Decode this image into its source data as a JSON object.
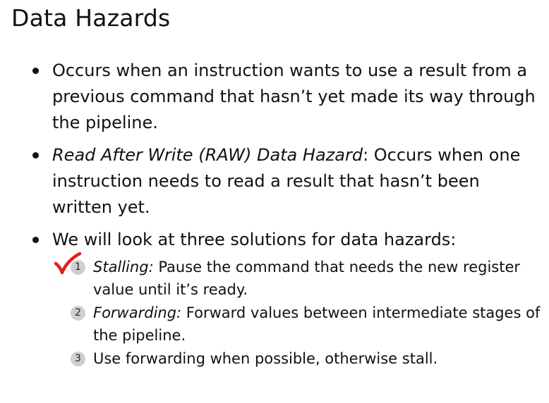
{
  "slide": {
    "title": "Data Hazards",
    "bullets": [
      {
        "text": "Occurs when an instruction wants to use a result from a previous command that hasn’t yet made its way through the pipeline."
      },
      {
        "italic": "Read After Write (RAW) Data Hazard",
        "text": ": Occurs when one instruction needs to read a result that hasn’t been written yet."
      },
      {
        "text": "We will look at three solutions for data hazards:",
        "solutions": [
          {
            "number": "1",
            "italic": "Stalling:",
            "text": " Pause the command that needs the new register value until it’s ready.",
            "annotation": "red-checkmark-icon"
          },
          {
            "number": "2",
            "italic": "Forwarding:",
            "text": " Forward values between intermediate stages of the pipeline."
          },
          {
            "number": "3",
            "text": "Use forwarding when possible, otherwise stall."
          }
        ]
      }
    ]
  },
  "colors": {
    "text": "#111111",
    "number_badge": "#cfcfcf",
    "checkmark": "#e0201b"
  }
}
